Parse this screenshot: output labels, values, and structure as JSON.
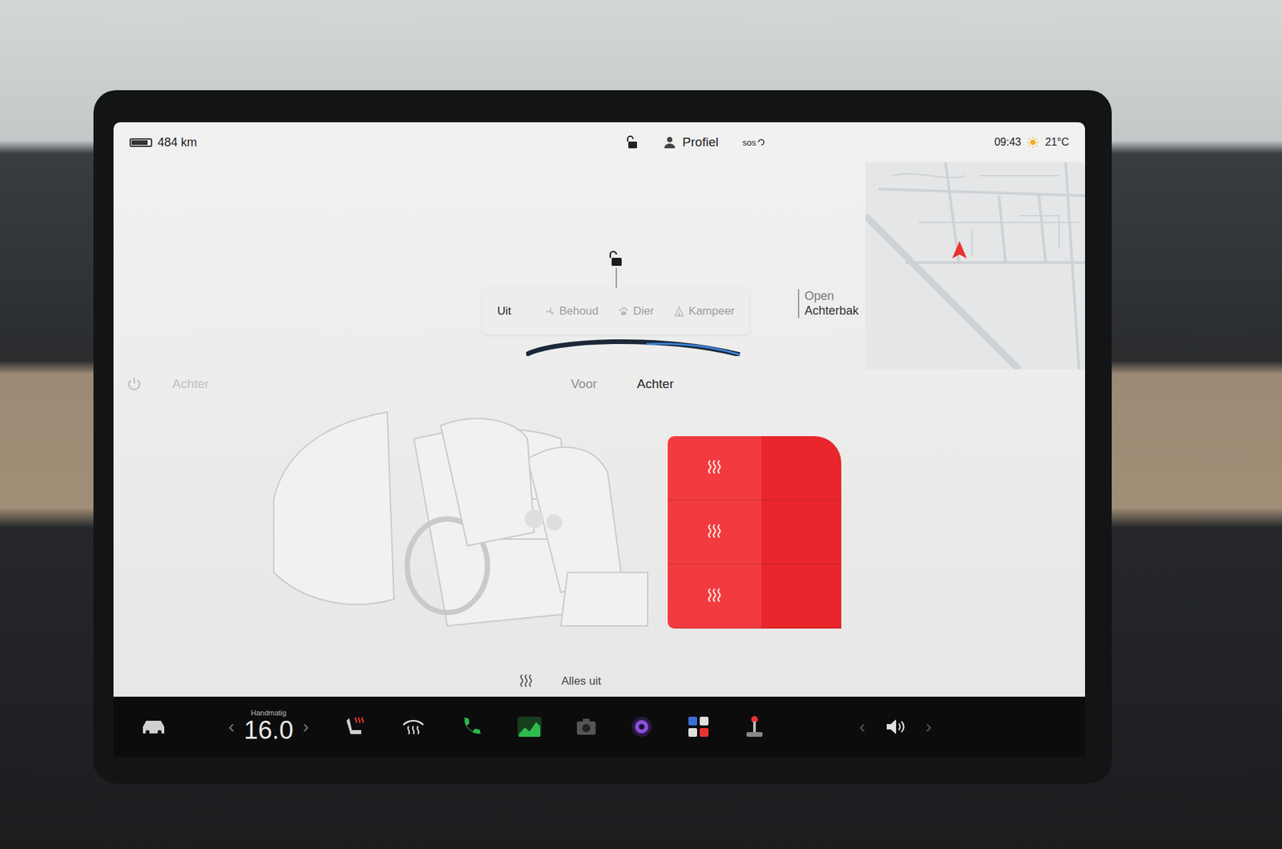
{
  "status_bar": {
    "range": "484 km",
    "battery_level": 0.85,
    "locked": false,
    "profile": "Profiel",
    "sos": "sos",
    "time": "09:43",
    "temperature": "21°C"
  },
  "trunk": {
    "locked": false,
    "line1": "Open",
    "line2": "Achterbak"
  },
  "climate_modes": [
    {
      "label": "Uit",
      "selected": true
    },
    {
      "label": "Behoud",
      "selected": false
    },
    {
      "label": "Dier",
      "selected": false
    },
    {
      "label": "Kampeer",
      "selected": false
    }
  ],
  "faded_panel": {
    "label": "Achter"
  },
  "seat_tabs": [
    {
      "label": "Voor",
      "selected": false
    },
    {
      "label": "Achter",
      "selected": true
    }
  ],
  "rear_seats": [
    {
      "heated": true
    },
    {
      "heated": true
    },
    {
      "heated": true
    }
  ],
  "all_off": {
    "label": "Alles uit"
  },
  "bottom_bar": {
    "temp_mode": "Handmatig",
    "temperature": "16.0",
    "temp_prev": "‹",
    "temp_next": "›",
    "volume_prev": "‹",
    "volume_next": "›"
  }
}
